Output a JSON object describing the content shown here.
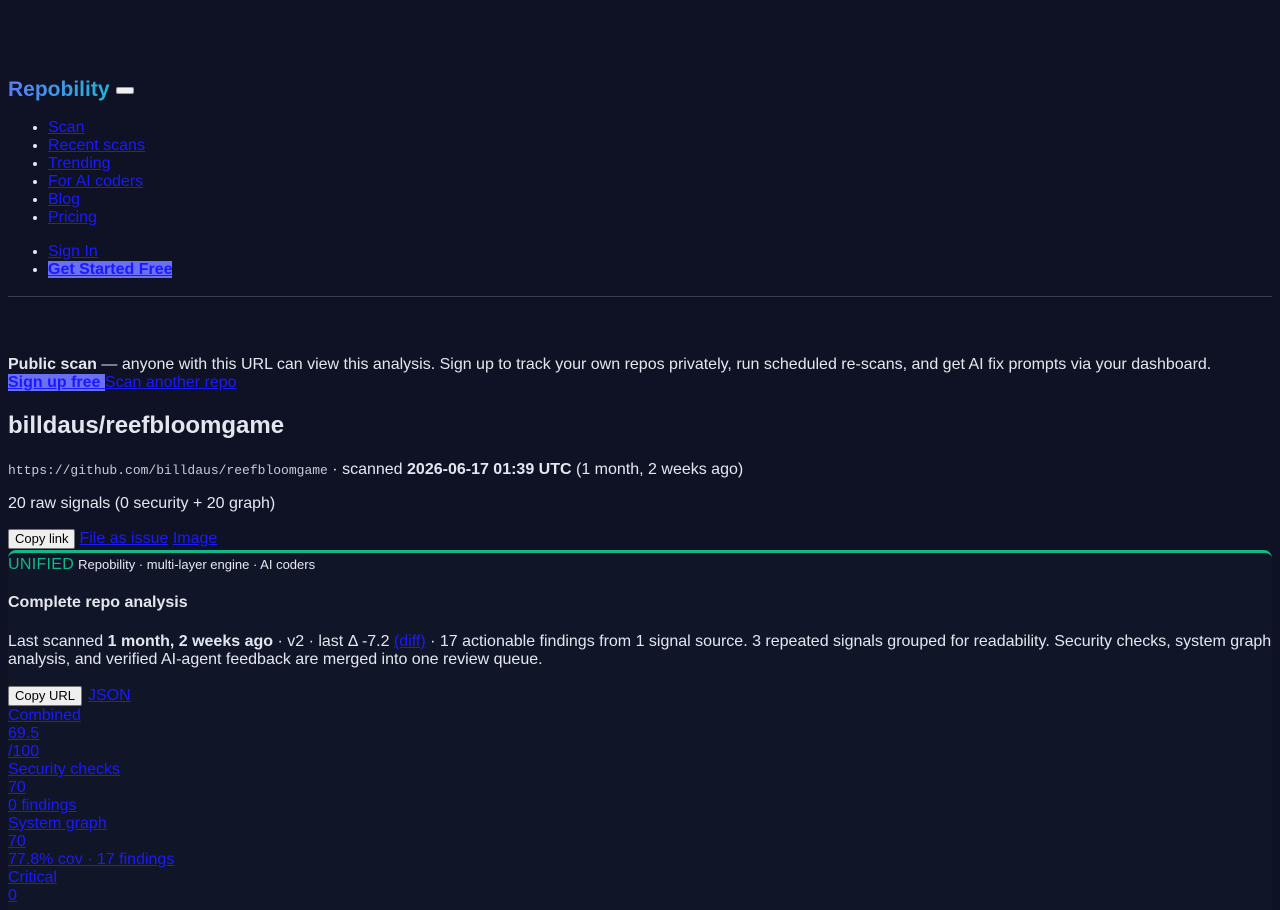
{
  "header": {
    "brand": "Repobility",
    "nav_items": [
      "Scan",
      "Recent scans",
      "Trending",
      "For AI coders",
      "Blog",
      "Pricing"
    ],
    "sign_in": "Sign In",
    "get_started": "Get Started Free"
  },
  "banner": {
    "bold": "Public scan",
    "text": " — anyone with this URL can view this analysis. Sign up to track your own repos privately, run scheduled re-scans, and get AI fix prompts via your dashboard.",
    "signup": "Sign up free ",
    "scan_another": "Scan another repo"
  },
  "repo": {
    "title": "billdaus/reefbloomgame",
    "url": "https://github.com/billdaus/reefbloomgame",
    "scanned_prefix": " · scanned ",
    "scanned_at": "2026-06-17 01:39 UTC",
    "scanned_ago": " (1 month, 2 weeks ago)",
    "signals": "20 raw signals (0 security + 20 graph)",
    "copy_link": "Copy link",
    "file_issue": "File as issue",
    "image": "Image"
  },
  "panel": {
    "label": "UNIFIED",
    "sub": "Repobility · multi-layer engine · AI coders",
    "heading": "Complete repo analysis",
    "desc_prefix": "Last scanned ",
    "desc_bold": "1 month, 2 weeks ago",
    "desc_mid": " · v2 · last Δ -7.2 ",
    "diff_link": "(diff)",
    "desc_suffix": " · 17 actionable findings from 1 signal source. 3 repeated signals grouped for readability. Security checks, system graph analysis, and verified AI-agent feedback are merged into one review queue.",
    "copy_url": "Copy URL",
    "json": "JSON",
    "stats": [
      "Combined",
      "69.5",
      "/100",
      "Security checks",
      "70",
      "0 findings",
      "System graph",
      "70",
      "77.8% cov · 17 findings",
      "Critical",
      "0"
    ]
  }
}
